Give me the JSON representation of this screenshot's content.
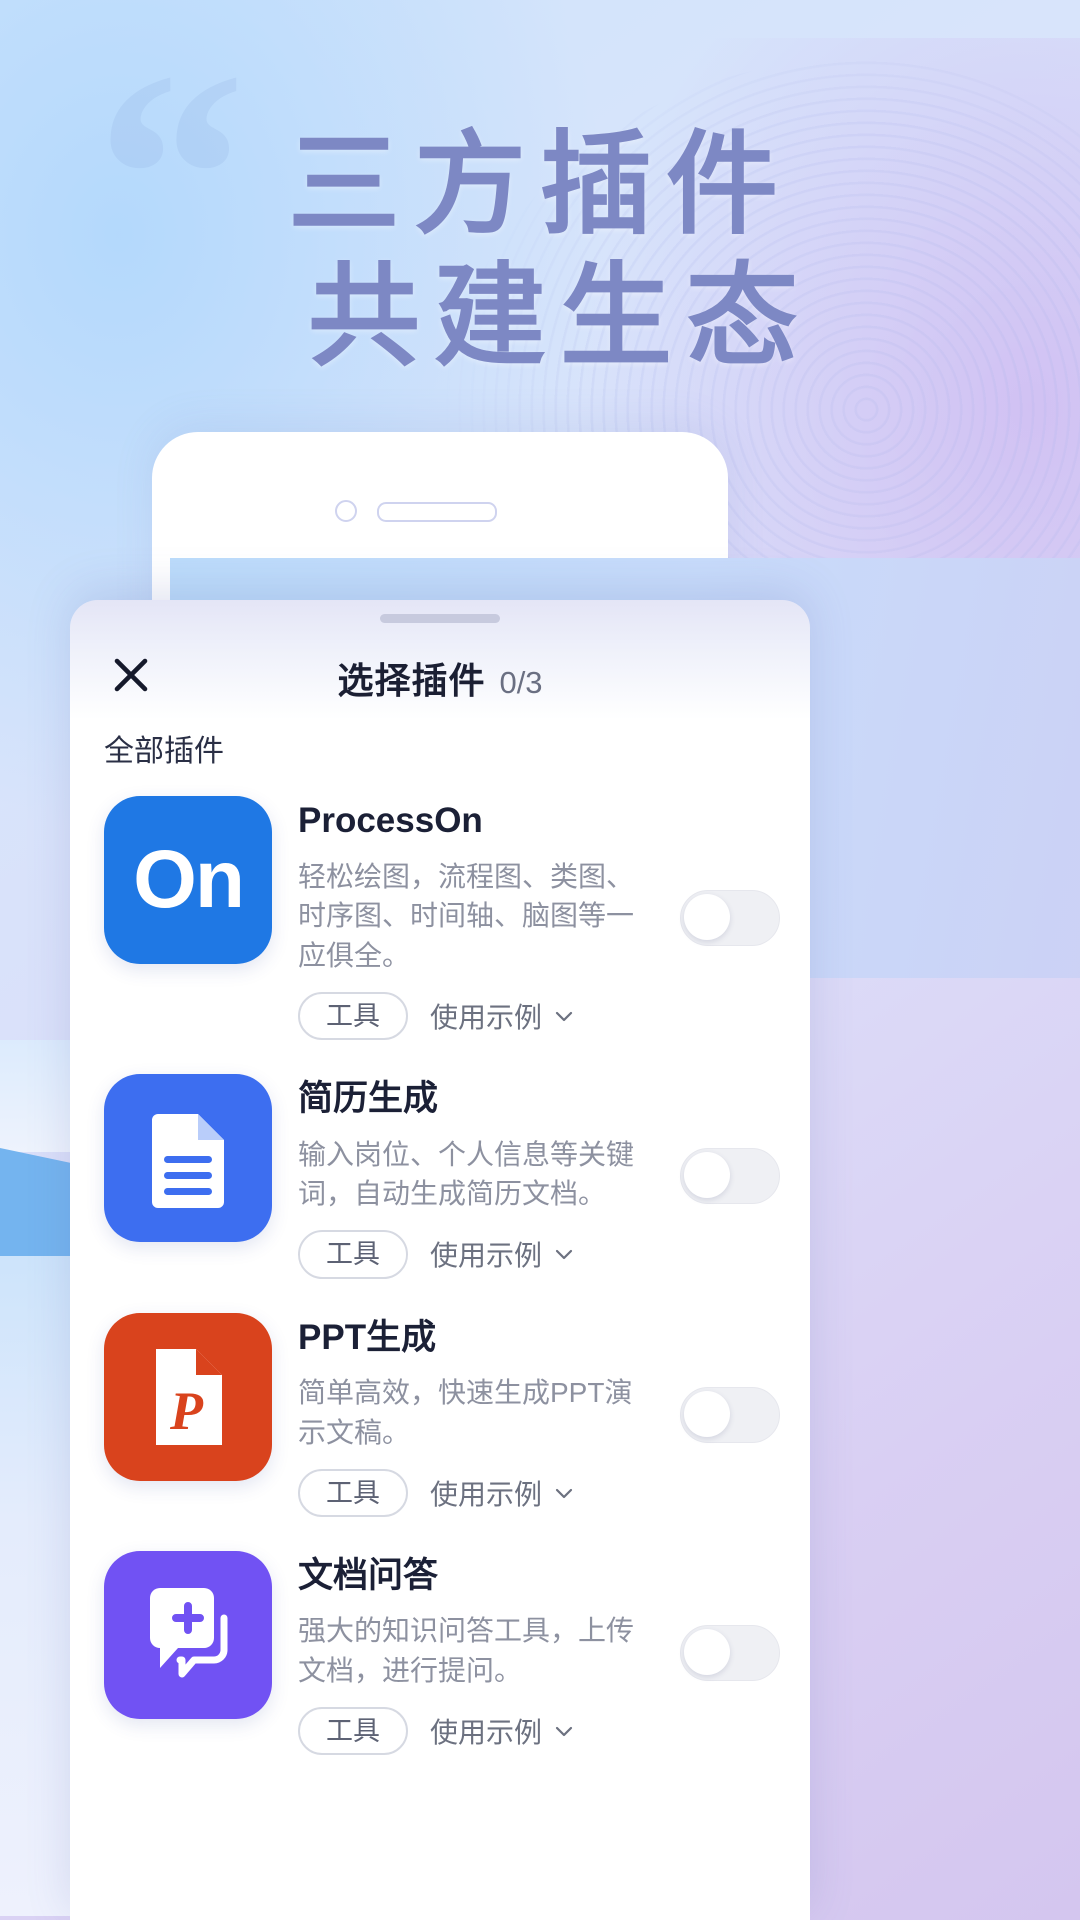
{
  "poster": {
    "quote_mark": "“",
    "line1": "三方插件",
    "line2": "共建生态"
  },
  "sheet": {
    "close_icon": "close-icon",
    "title": "选择插件",
    "count": "0/3",
    "section_label": "全部插件",
    "plugins": [
      {
        "name": "ProcessOn",
        "desc": "轻松绘图，流程图、类图、时序图、时间轴、脑图等一应俱全。",
        "tag": "工具",
        "example_label": "使用示例",
        "icon": "processon-on-icon",
        "icon_bg": "#1f78e4",
        "enabled": false
      },
      {
        "name": "简历生成",
        "desc": "输入岗位、个人信息等关键词，自动生成简历文档。",
        "tag": "工具",
        "example_label": "使用示例",
        "icon": "document-lines-icon",
        "icon_bg": "#3d6ef0",
        "enabled": false
      },
      {
        "name": "PPT生成",
        "desc": "简单高效，快速生成PPT演示文稿。",
        "tag": "工具",
        "example_label": "使用示例",
        "icon": "powerpoint-file-icon",
        "icon_bg": "#d9431d",
        "enabled": false
      },
      {
        "name": "文档问答",
        "desc": "强大的知识问答工具，上传文档，进行提问。",
        "tag": "工具",
        "example_label": "使用示例",
        "icon": "chat-plus-icon",
        "icon_bg": "#7152f3",
        "enabled": false
      }
    ]
  },
  "colors": {
    "title_text": "#1b1f33",
    "poster_text": "#7d88c4",
    "desc_text": "#8d91a0"
  }
}
